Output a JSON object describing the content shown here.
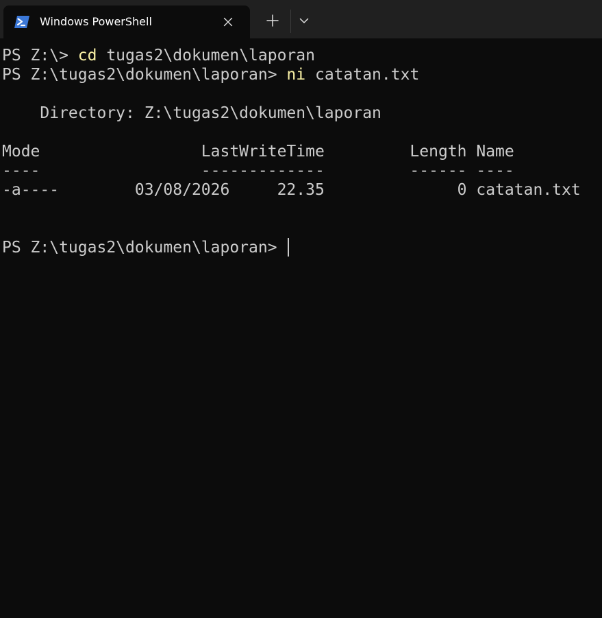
{
  "tab": {
    "title": "Windows PowerShell",
    "icon": "powershell-icon",
    "close_icon": "close-icon"
  },
  "tabbar": {
    "new_tab_icon": "plus-icon",
    "dropdown_icon": "chevron-down-icon"
  },
  "colors": {
    "background": "#0c0c0c",
    "tabbar": "#202020",
    "text": "#cccccc",
    "command": "#f9f1a5",
    "icon_blue": "#3b78d8"
  },
  "terminal": {
    "line1": {
      "prompt": "PS Z:\\> ",
      "command": "cd",
      "args": " tugas2\\dokumen\\laporan"
    },
    "line2": {
      "prompt": "PS Z:\\tugas2\\dokumen\\laporan> ",
      "command": "ni",
      "args": " catatan.txt"
    },
    "directory_line": "    Directory: Z:\\tugas2\\dokumen\\laporan",
    "header_line": "Mode                 LastWriteTime         Length Name",
    "separator_line": "----                 -------------         ------ ----",
    "row_line": "-a----        03/08/2026     22.35              0 catatan.txt",
    "final_prompt": "PS Z:\\tugas2\\dokumen\\laporan> "
  }
}
